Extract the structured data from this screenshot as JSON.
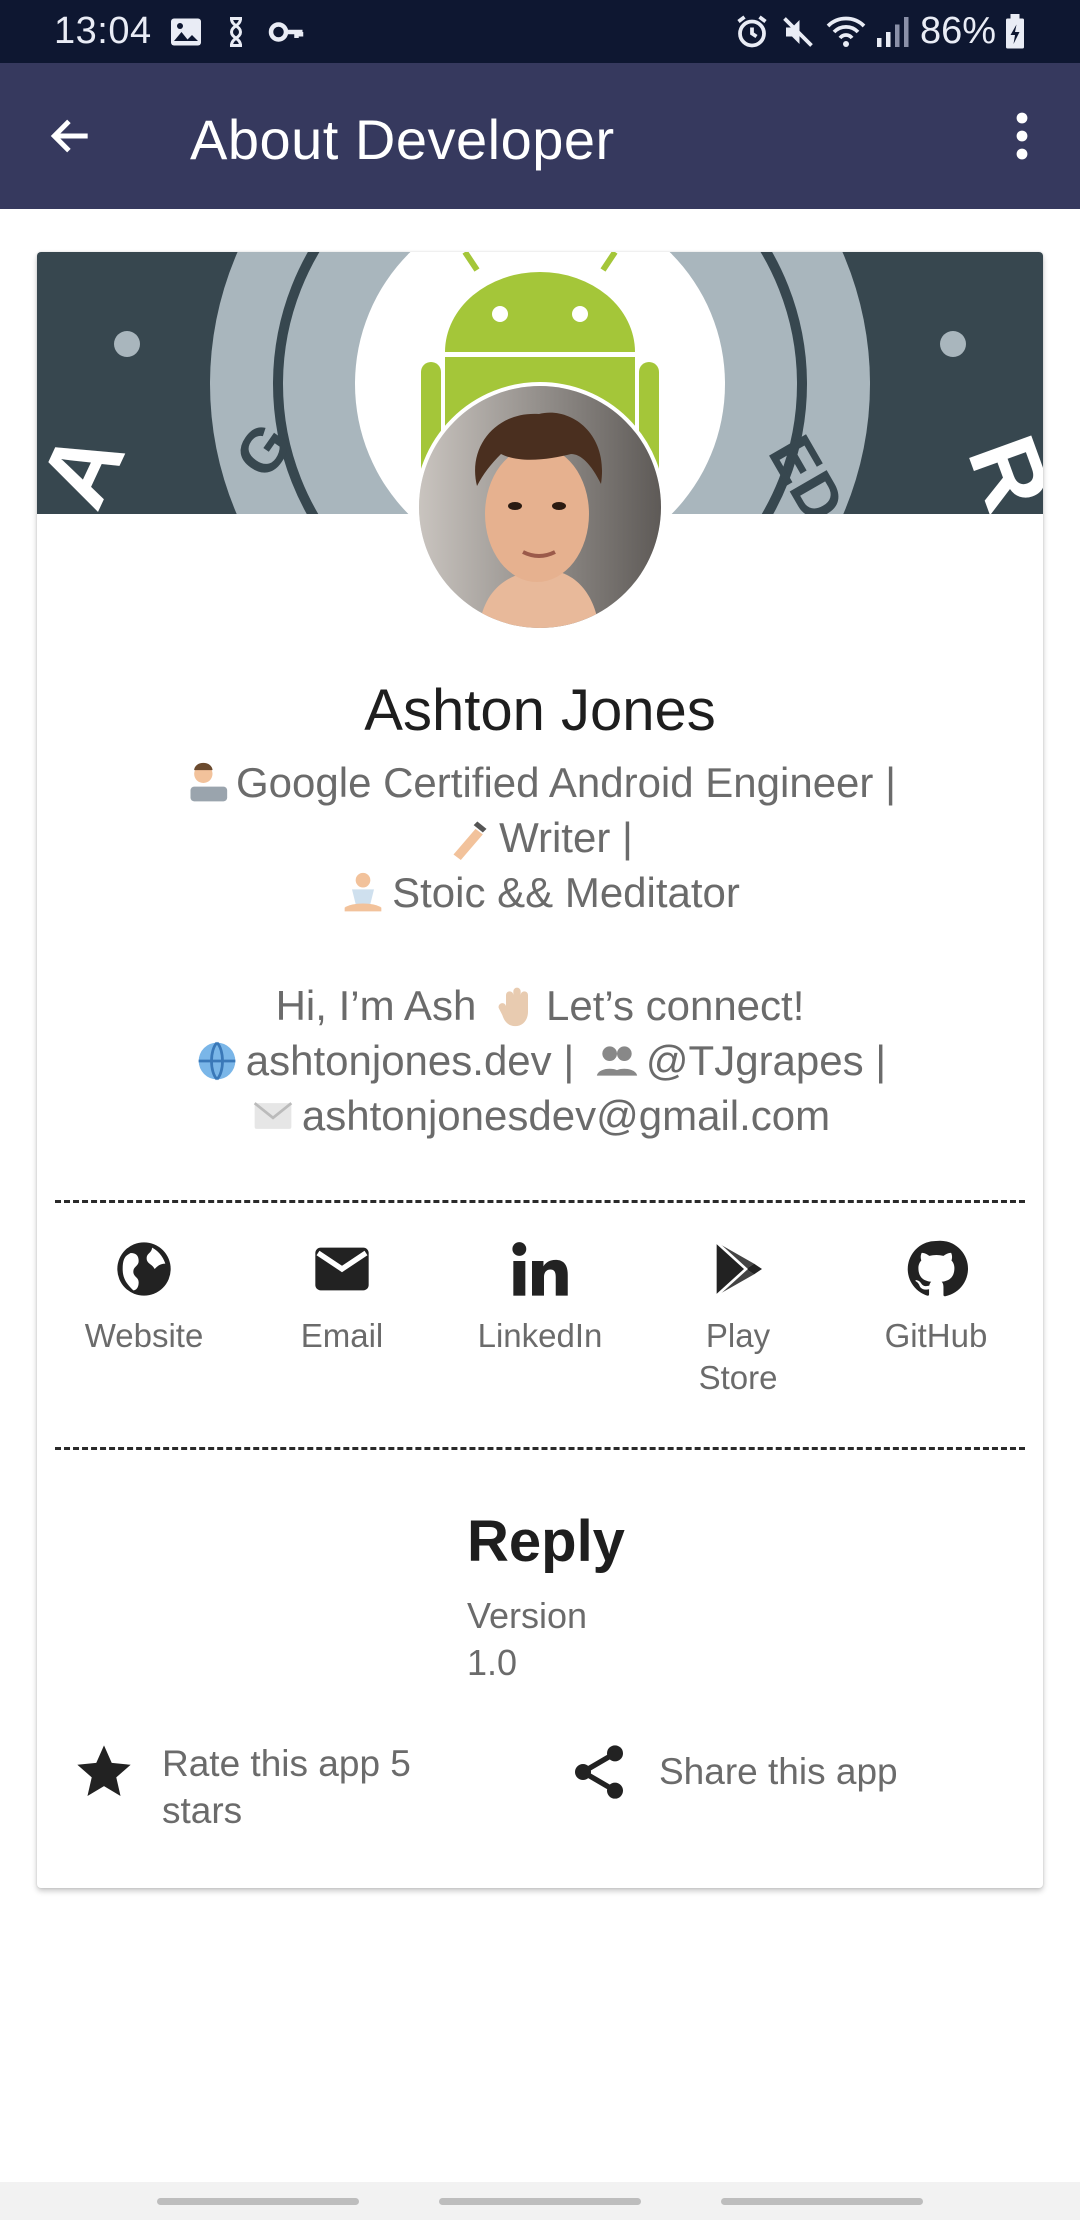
{
  "status_bar": {
    "time": "13:04",
    "battery": "86%",
    "icons": [
      "image-icon",
      "sync-icon",
      "key-icon",
      "alarm-icon",
      "mute-icon",
      "wifi-icon",
      "signal-icon",
      "battery-icon"
    ]
  },
  "app_bar": {
    "title": "About Developer",
    "back_icon": "arrow-back-icon",
    "menu_icon": "more-vert-icon",
    "color": "#36395e"
  },
  "profile": {
    "name": "Ashton Jones",
    "bio_lines": [
      "Google Certified Android Engineer |",
      "Writer |",
      "Stoic && Meditator"
    ],
    "greeting": "Hi, I’m Ash",
    "greeting_tail": "Let’s connect!",
    "website": "ashtonjones.dev |",
    "handle": "@TJgrapes |",
    "email": "ashtonjonesdev@gmail.com"
  },
  "links": [
    {
      "label": "Website",
      "icon": "globe-icon"
    },
    {
      "label": "Email",
      "icon": "mail-icon"
    },
    {
      "label": "LinkedIn",
      "icon": "linkedin-icon"
    },
    {
      "label": "Play\nStore",
      "label_line1": "Play",
      "label_line2": "Store",
      "icon": "play-store-icon"
    },
    {
      "label": "GitHub",
      "icon": "github-icon"
    }
  ],
  "app_info": {
    "name": "Reply",
    "version_label": "Version",
    "version_number": "1.0"
  },
  "actions": {
    "rate_line1": "Rate this app 5",
    "rate_line2": "stars",
    "share": "Share this app"
  }
}
